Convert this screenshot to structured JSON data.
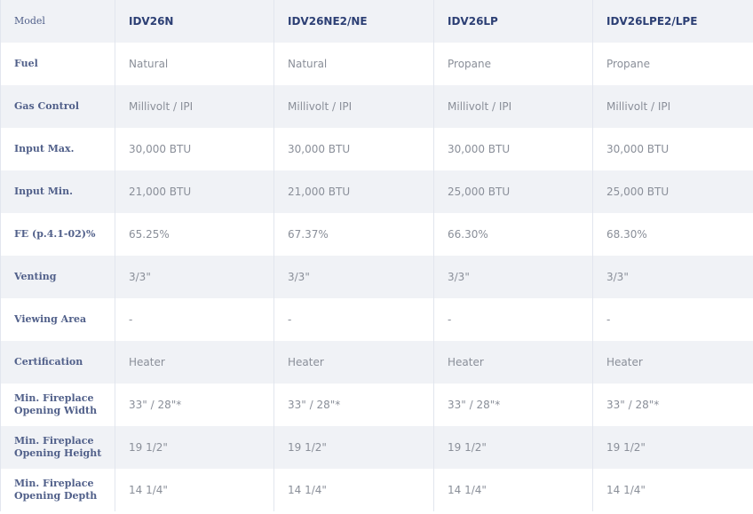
{
  "table": {
    "header": {
      "label": "Model",
      "models": [
        "IDV26N",
        "IDV26NE2/NE",
        "IDV26LP",
        "IDV26LPE2/LPE"
      ]
    },
    "rows": [
      {
        "label": "Fuel",
        "values": [
          "Natural",
          "Natural",
          "Propane",
          "Propane"
        ]
      },
      {
        "label": "Gas Control",
        "values": [
          "Millivolt / IPI",
          "Millivolt / IPI",
          "Millivolt / IPI",
          "Millivolt / IPI"
        ]
      },
      {
        "label": "Input Max.",
        "values": [
          "30,000 BTU",
          "30,000 BTU",
          "30,000 BTU",
          "30,000 BTU"
        ]
      },
      {
        "label": "Input Min.",
        "values": [
          "21,000 BTU",
          "21,000 BTU",
          "25,000 BTU",
          "25,000 BTU"
        ]
      },
      {
        "label": "FE (p.4.1-02)%",
        "values": [
          "65.25%",
          "67.37%",
          "66.30%",
          "68.30%"
        ]
      },
      {
        "label": "Venting",
        "values": [
          "3/3\"",
          "3/3\"",
          "3/3\"",
          "3/3\""
        ]
      },
      {
        "label": "Viewing Area",
        "values": [
          "-",
          "-",
          "-",
          "-"
        ]
      },
      {
        "label": "Certification",
        "values": [
          "Heater",
          "Heater",
          "Heater",
          "Heater"
        ]
      },
      {
        "label_lines": [
          "Min. Fireplace",
          "Opening Width"
        ],
        "values": [
          "33\" / 28\"*",
          "33\" / 28\"*",
          "33\" / 28\"*",
          "33\" / 28\"*"
        ]
      },
      {
        "label_lines": [
          "Min. Fireplace",
          "Opening Height"
        ],
        "values": [
          "19 1/2\"",
          "19 1/2\"",
          "19 1/2\"",
          "19 1/2\""
        ]
      },
      {
        "label_lines": [
          "Min. Fireplace",
          "Opening Depth"
        ],
        "values": [
          "14 1/4\"",
          "14 1/4\"",
          "14 1/4\"",
          "14 1/4\""
        ]
      }
    ]
  },
  "colors": {
    "label_text": "#51608a",
    "model_text": "#2c3f74",
    "value_text": "#8a8f99",
    "stripe": "#f0f2f6",
    "divider": "#e2e6ee"
  }
}
